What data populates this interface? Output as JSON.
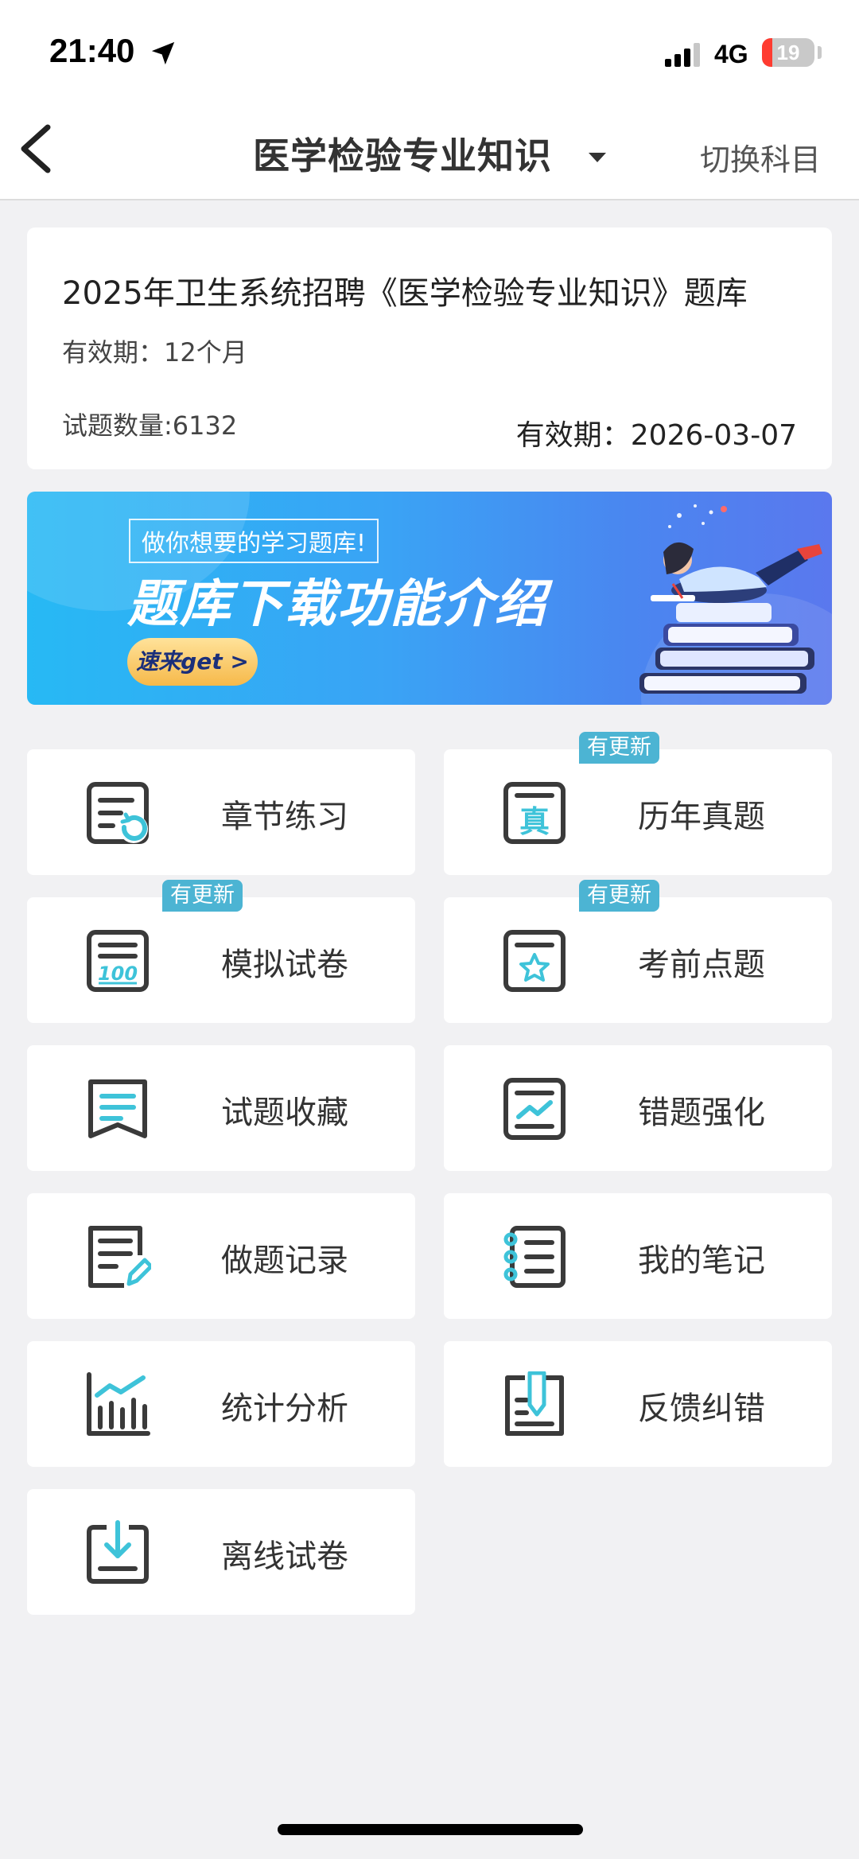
{
  "status_bar": {
    "time": "21:40",
    "network": "4G",
    "battery": "19",
    "battery_level": 0.19,
    "icons": [
      "location-arrow-icon",
      "signal-icon",
      "battery-icon"
    ]
  },
  "nav": {
    "back_icon": "chevron-left-icon",
    "title": "医学检验专业知识",
    "dropdown_icon": "caret-down-icon",
    "switch_label": "切换科目"
  },
  "info_card": {
    "title": "2025年卫生系统招聘《医学检验专业知识》题库",
    "validity": "有效期：12个月",
    "count": "试题数量:6132",
    "expiry": "有效期：2026-03-07"
  },
  "banner": {
    "tag": "做你想要的学习题库!",
    "headline": "题库下载功能介绍",
    "cta": "速来get >"
  },
  "colors": {
    "accent": "#3ec3d9",
    "icon_dark": "#3a3a3a",
    "badge": "#4cb4d3",
    "page_bg": "#f1f1f3"
  },
  "tiles": [
    {
      "label": "章节练习",
      "icon": "chapter-practice-icon",
      "badge": ""
    },
    {
      "label": "历年真题",
      "icon": "past-exams-icon",
      "badge": "有更新"
    },
    {
      "label": "模拟试卷",
      "icon": "mock-exam-icon",
      "badge": "有更新"
    },
    {
      "label": "考前点题",
      "icon": "pre-exam-tips-icon",
      "badge": "有更新"
    },
    {
      "label": "试题收藏",
      "icon": "bookmark-icon",
      "badge": ""
    },
    {
      "label": "错题强化",
      "icon": "wrong-question-icon",
      "badge": ""
    },
    {
      "label": "做题记录",
      "icon": "record-edit-icon",
      "badge": ""
    },
    {
      "label": "我的笔记",
      "icon": "notebook-icon",
      "badge": ""
    },
    {
      "label": "统计分析",
      "icon": "bar-chart-icon",
      "badge": ""
    },
    {
      "label": "反馈纠错",
      "icon": "feedback-icon",
      "badge": ""
    },
    {
      "label": "离线试卷",
      "icon": "download-icon",
      "badge": ""
    }
  ]
}
